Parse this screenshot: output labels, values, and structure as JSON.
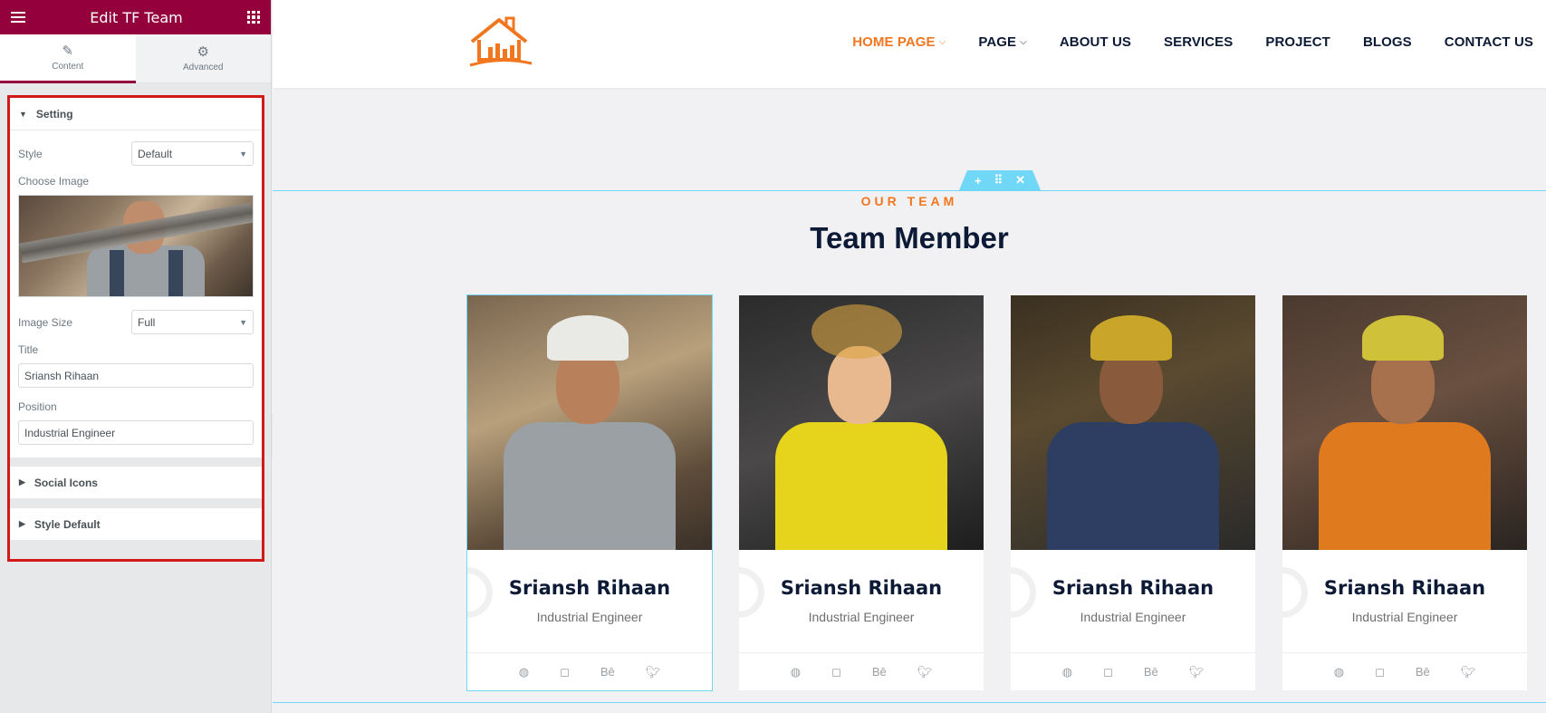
{
  "panel": {
    "title": "Edit TF Team",
    "tabs": [
      {
        "label": "Content",
        "icon": "pencil-icon"
      },
      {
        "label": "Advanced",
        "icon": "gear-icon"
      }
    ],
    "setting": {
      "heading": "Setting",
      "style_label": "Style",
      "style_value": "Default",
      "choose_image_label": "Choose Image",
      "image_size_label": "Image Size",
      "image_size_value": "Full",
      "title_label": "Title",
      "title_value": "Sriansh Rihaan",
      "position_label": "Position",
      "position_value": "Industrial Engineer"
    },
    "social_icons_heading": "Social Icons",
    "style_default_heading": "Style Default",
    "accent_color": "#93003c"
  },
  "site": {
    "nav": [
      {
        "label": "HOME PAGE",
        "dropdown": true,
        "active": true
      },
      {
        "label": "PAGE",
        "dropdown": true,
        "active": false
      },
      {
        "label": "ABOUT US",
        "dropdown": false,
        "active": false
      },
      {
        "label": "SERVICES",
        "dropdown": false,
        "active": false
      },
      {
        "label": "PROJECT",
        "dropdown": false,
        "active": false
      },
      {
        "label": "BLOGS",
        "dropdown": false,
        "active": false
      },
      {
        "label": "CONTACT US",
        "dropdown": false,
        "active": false
      }
    ],
    "brand_color": "#f07620",
    "eyebrow": "OUR TEAM",
    "heading": "Team Member",
    "handle_icons": [
      "+",
      "⠿",
      "✕"
    ],
    "members": [
      {
        "name": "Sriansh Rihaan",
        "role": "Industrial Engineer"
      },
      {
        "name": "Sriansh Rihaan",
        "role": "Industrial Engineer"
      },
      {
        "name": "Sriansh Rihaan",
        "role": "Industrial Engineer"
      },
      {
        "name": "Sriansh Rihaan",
        "role": "Industrial Engineer"
      }
    ],
    "social_icons": [
      "dribbble-icon",
      "instagram-icon",
      "behance-icon",
      "twitter-icon"
    ],
    "behance_text": "Bē"
  }
}
